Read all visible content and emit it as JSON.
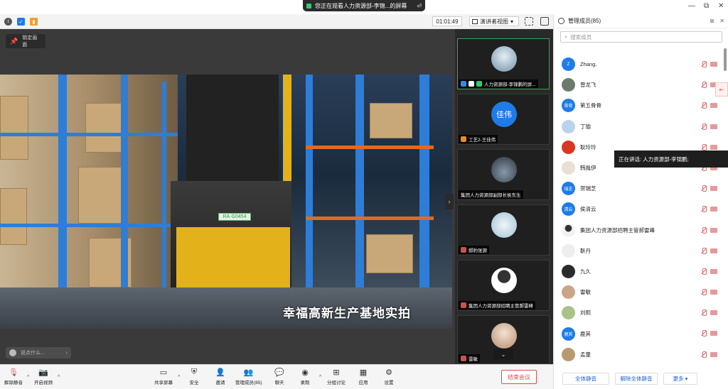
{
  "titlebar": {
    "share_notice": "您正在观看人力资源部-李锦...的屏幕",
    "share_exit_label": "⏎",
    "window_controls": [
      "—",
      "⧉",
      "✕"
    ]
  },
  "topbar": {
    "timer": "01:01:49",
    "view_mode": "演讲者视图",
    "view_caret": "▾"
  },
  "stage": {
    "lock_label": "锁定画面",
    "chat_placeholder": "说点什么...",
    "chat_caret": "‹",
    "collapse_arrow": "›",
    "video_caption": "幸福高新生产基地实拍",
    "forklift_plate": "RA·G0454"
  },
  "tiles": [
    {
      "name": "人力资源部-李锦鹏的屏...",
      "active": true,
      "avatar_color": "#6f8fa8",
      "icon_color": "#2d8cf0",
      "avatar_text": ""
    },
    {
      "name": "工艺2-王佳伟",
      "active": false,
      "avatar_color": "#1f7be8",
      "icon_color": "#f08a24",
      "avatar_text": "佳伟"
    },
    {
      "name": "集团人力资源部副部长侯东生",
      "active": false,
      "avatar_color": "#3b4552",
      "icon_color": "#888",
      "avatar_text": ""
    },
    {
      "name": "郝豹张源",
      "active": false,
      "avatar_color": "#9fc3d8",
      "icon_color": "#d05050",
      "avatar_text": ""
    },
    {
      "name": "集团人力资源部招聘主管郝雷峰",
      "active": false,
      "avatar_color": "#ffffff",
      "icon_color": "#d05050",
      "avatar_text": ""
    },
    {
      "name": "雷敏",
      "active": false,
      "avatar_color": "#d9b9a0",
      "icon_color": "#d05050",
      "avatar_text": ""
    }
  ],
  "tiles_more": "⌄",
  "panel": {
    "title": "管理成员(85)",
    "search_placeholder": "搜索成员",
    "speaking_notice": "正在讲话: 人力资源部-李锦鹏;",
    "side_tab": "⇤",
    "members": [
      {
        "name": "Zhang.",
        "avatar_text": "Z",
        "avatar_color": "#1f7be8"
      },
      {
        "name": "曾龙飞",
        "avatar_text": "",
        "avatar_color": "#6c7a6c"
      },
      {
        "name": "第五骨骨",
        "avatar_text": "骨骨",
        "avatar_color": "#1f7be8"
      },
      {
        "name": "丁瑜",
        "avatar_text": "",
        "avatar_color": "#b9d3ec"
      },
      {
        "name": "耿玲玲",
        "avatar_text": "",
        "avatar_color": "#d9361f"
      },
      {
        "name": "韩胤伊",
        "avatar_text": "",
        "avatar_color": "#e8e0d4"
      },
      {
        "name": "贺瑞芝",
        "avatar_text": "瑞芝",
        "avatar_color": "#1f7be8"
      },
      {
        "name": "侯清云",
        "avatar_text": "清云",
        "avatar_color": "#1f7be8"
      },
      {
        "name": "集团人力资源部招聘主管郝雷峰",
        "avatar_text": "",
        "avatar_color": "#f2f2f2"
      },
      {
        "name": "靳丹",
        "avatar_text": "",
        "avatar_color": "#eeeeee"
      },
      {
        "name": "九久",
        "avatar_text": "",
        "avatar_color": "#2b2b2b"
      },
      {
        "name": "雷敏",
        "avatar_text": "",
        "avatar_color": "#c9a68a"
      },
      {
        "name": "刘熙",
        "avatar_text": "",
        "avatar_color": "#a8c28a"
      },
      {
        "name": "鹿其",
        "avatar_text": "鹿其",
        "avatar_color": "#1f7be8"
      },
      {
        "name": "孟童",
        "avatar_text": "",
        "avatar_color": "#b89a70"
      }
    ],
    "footer": {
      "mute_all": "全体静音",
      "unmute_all": "解除全体静音",
      "more": "更多 ▾"
    }
  },
  "bottombar": {
    "items": [
      {
        "label": "解除静音",
        "glyph": "🎙"
      },
      {
        "label": "开启视频",
        "glyph": "📷"
      },
      {
        "label": "共享屏幕",
        "glyph": "▭"
      },
      {
        "label": "安全",
        "glyph": "⛨"
      },
      {
        "label": "邀请",
        "glyph": "👤"
      },
      {
        "label": "管理成员(85)",
        "glyph": "👥"
      },
      {
        "label": "聊天",
        "glyph": "💬"
      },
      {
        "label": "录制",
        "glyph": "◉"
      },
      {
        "label": "分组讨论",
        "glyph": "⊞"
      },
      {
        "label": "应用",
        "glyph": "▦"
      },
      {
        "label": "设置",
        "glyph": "⚙"
      }
    ],
    "caret": "^",
    "end_label": "结束会议"
  },
  "colors": {
    "accent": "#1f7be8",
    "danger": "#e24a4a",
    "active_border": "#2ea64f"
  }
}
